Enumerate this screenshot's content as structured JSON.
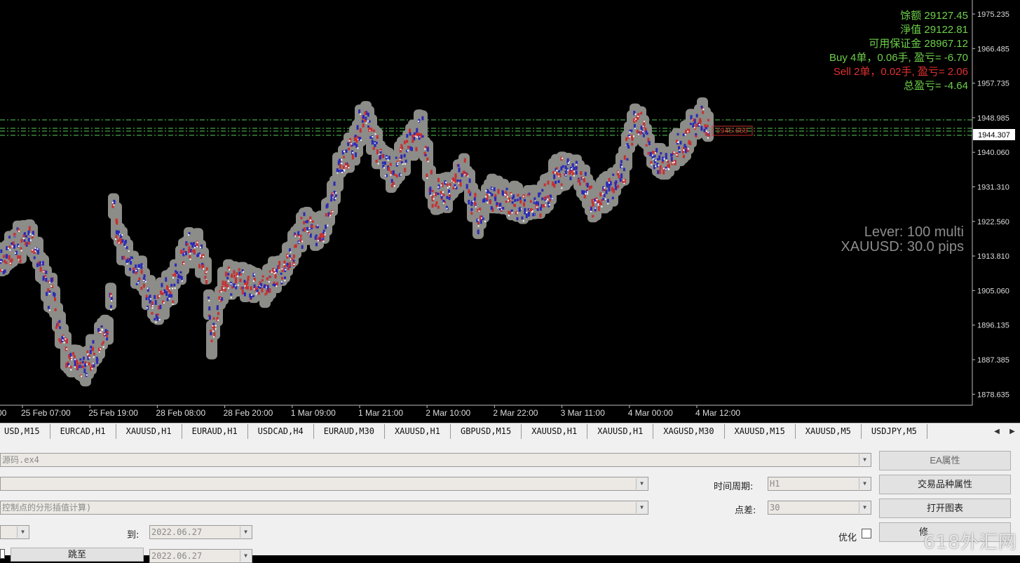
{
  "chart": {
    "price_axis": [
      "1975.235",
      "1966.485",
      "1957.735",
      "1948.985",
      "1940.060",
      "1931.310",
      "1922.560",
      "1913.810",
      "1905.060",
      "1896.135",
      "1887.385",
      "1878.635"
    ],
    "current_price": "1944.307",
    "marker_price": "1945.659",
    "time_axis": [
      "00",
      "25 Feb 07:00",
      "25 Feb 19:00",
      "28 Feb 08:00",
      "28 Feb 20:00",
      "1 Mar 09:00",
      "1 Mar 21:00",
      "2 Mar 10:00",
      "2 Mar 22:00",
      "3 Mar 11:00",
      "4 Mar 00:00",
      "4 Mar 12:00"
    ],
    "account": {
      "balance_label": "馀额",
      "balance_value": "29127.45",
      "equity_label": "淨值",
      "equity_value": "29122.81",
      "margin_label": "可用保证金",
      "margin_value": "28967.12",
      "buy_line": "Buy 4单，0.06手,  盈亏= -6.70",
      "sell_line": "Sell 2单，0.02手,  盈亏= 2.06",
      "total_line": "总盈亏= -4.64"
    },
    "lever": "Lever: 100 multi",
    "spread_info": "XAUUSD: 30.0 pips",
    "colors": {
      "green_text": "#6dd04a",
      "red_text": "#e03030",
      "level_line": "#55cc55",
      "bull": "#c83030",
      "bear": "#2a2ab8",
      "halo": "#8c8c88"
    }
  },
  "tabs": [
    "USD,M15",
    "EURCAD,H1",
    "XAUUSD,H1",
    "EURAUD,H1",
    "USDCAD,H4",
    "EURAUD,M30",
    "XAUUSD,H1",
    "GBPUSD,M15",
    "XAUUSD,H1",
    "XAUUSD,H1",
    "XAGUSD,M30",
    "XAUUSD,M15",
    "XAUUSD,M5",
    "USDJPY,M5"
  ],
  "tester": {
    "ea_field": "源码.ex4",
    "model_field": "控制点的分形插值计算)",
    "period_label": "时间周期:",
    "period_value": "H1",
    "spread_label": "点差:",
    "spread_value": "30",
    "to_label": "到:",
    "to_date": "2022.06.27",
    "date2": "2022.06.27",
    "optimize_label": "优化",
    "btn_ea_props": "EA属性",
    "btn_symbol_props": "交易品种属性",
    "btn_open_chart": "打开图表",
    "btn_modify": "修",
    "btn_skip": "跳至"
  },
  "watermark": "618外汇网"
}
